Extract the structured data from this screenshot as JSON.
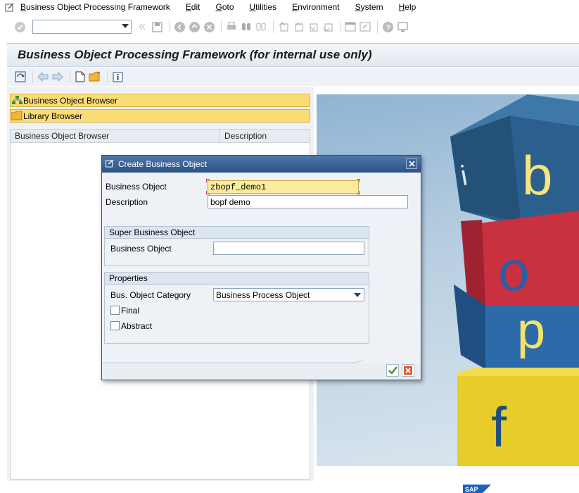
{
  "menubar": {
    "items": [
      "Business Object Processing Framework",
      "Edit",
      "Goto",
      "Utilities",
      "Environment",
      "System",
      "Help"
    ]
  },
  "title": "Business Object Processing Framework (for internal use only)",
  "left_pane": {
    "nav1": "Business Object Browser",
    "nav2": "Library Browser",
    "tree_header": {
      "col1": "Business Object Browser",
      "col2": "Description"
    }
  },
  "image_blocks": {
    "letters": [
      "i",
      "b",
      "o",
      "p",
      "f"
    ]
  },
  "dialog": {
    "title": "Create Business Object",
    "business_object_label": "Business Object",
    "business_object_value": "zbopf_demo1",
    "description_label": "Description",
    "description_value": "bopf demo",
    "super_group": {
      "title": "Super Business Object",
      "business_object_label": "Business Object",
      "business_object_value": ""
    },
    "properties_group": {
      "title": "Properties",
      "category_label": "Bus. Object Category",
      "category_value": "Business Process Object",
      "final_label": "Final",
      "final_checked": false,
      "abstract_label": "Abstract",
      "abstract_checked": false
    }
  },
  "colors": {
    "nav_bar": "#fbdd75",
    "dialog_title": "#2b5284",
    "required_field": "#fcec9d"
  }
}
